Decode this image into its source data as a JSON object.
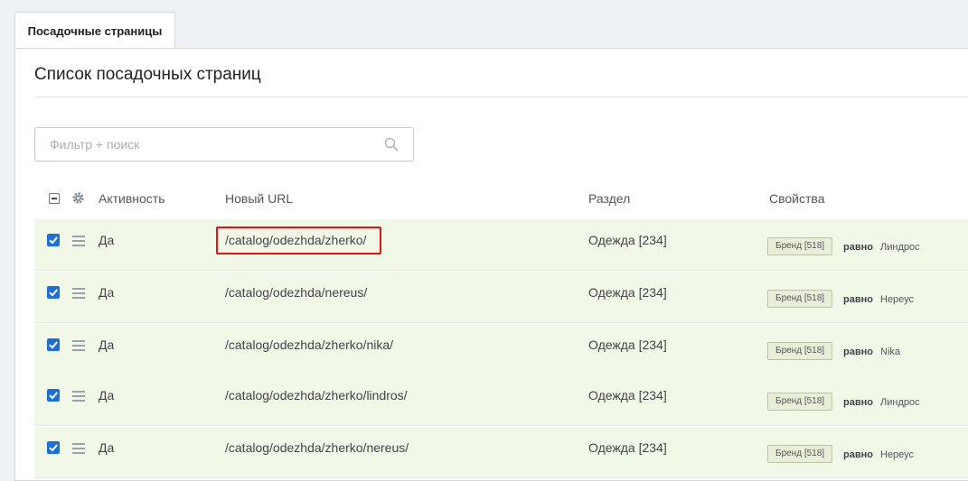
{
  "tabs": [
    {
      "label": "Посадочные страницы"
    }
  ],
  "page": {
    "title": "Список посадочных страниц"
  },
  "search": {
    "placeholder": "Фильтр + поиск",
    "icon": "search-icon"
  },
  "table": {
    "columns": {
      "activity": "Активность",
      "new_url": "Новый URL",
      "section": "Раздел",
      "properties": "Свойства"
    },
    "rows": [
      {
        "checked": true,
        "activity": "Да",
        "url": "/catalog/odezhda/zherko/",
        "section": "Одежда [234]",
        "prop_badge": "Бренд [518]",
        "condition": "равно",
        "value": "Линдрос",
        "highlighted": true
      },
      {
        "checked": true,
        "activity": "Да",
        "url": "/catalog/odezhda/nereus/",
        "section": "Одежда [234]",
        "prop_badge": "Бренд [518]",
        "condition": "равно",
        "value": "Нереус"
      },
      {
        "checked": true,
        "activity": "Да",
        "url": "/catalog/odezhda/zherko/nika/",
        "section": "Одежда [234]",
        "prop_badge": "Бренд [518]",
        "condition": "равно",
        "value": "Nika"
      },
      {
        "checked": true,
        "activity": "Да",
        "url": "/catalog/odezhda/zherko/lindros/",
        "section": "Одежда [234]",
        "prop_badge": "Бренд [518]",
        "condition": "равно",
        "value": "Линдрос"
      },
      {
        "checked": true,
        "activity": "Да",
        "url": "/catalog/odezhda/zherko/nereus/",
        "section": "Одежда [234]",
        "prop_badge": "Бренд [518]",
        "condition": "равно",
        "value": "Нереус"
      }
    ]
  },
  "colors": {
    "row_bg": "#f1f8e7",
    "checkbox": "#1d6fd6",
    "highlight": "#e01414"
  }
}
